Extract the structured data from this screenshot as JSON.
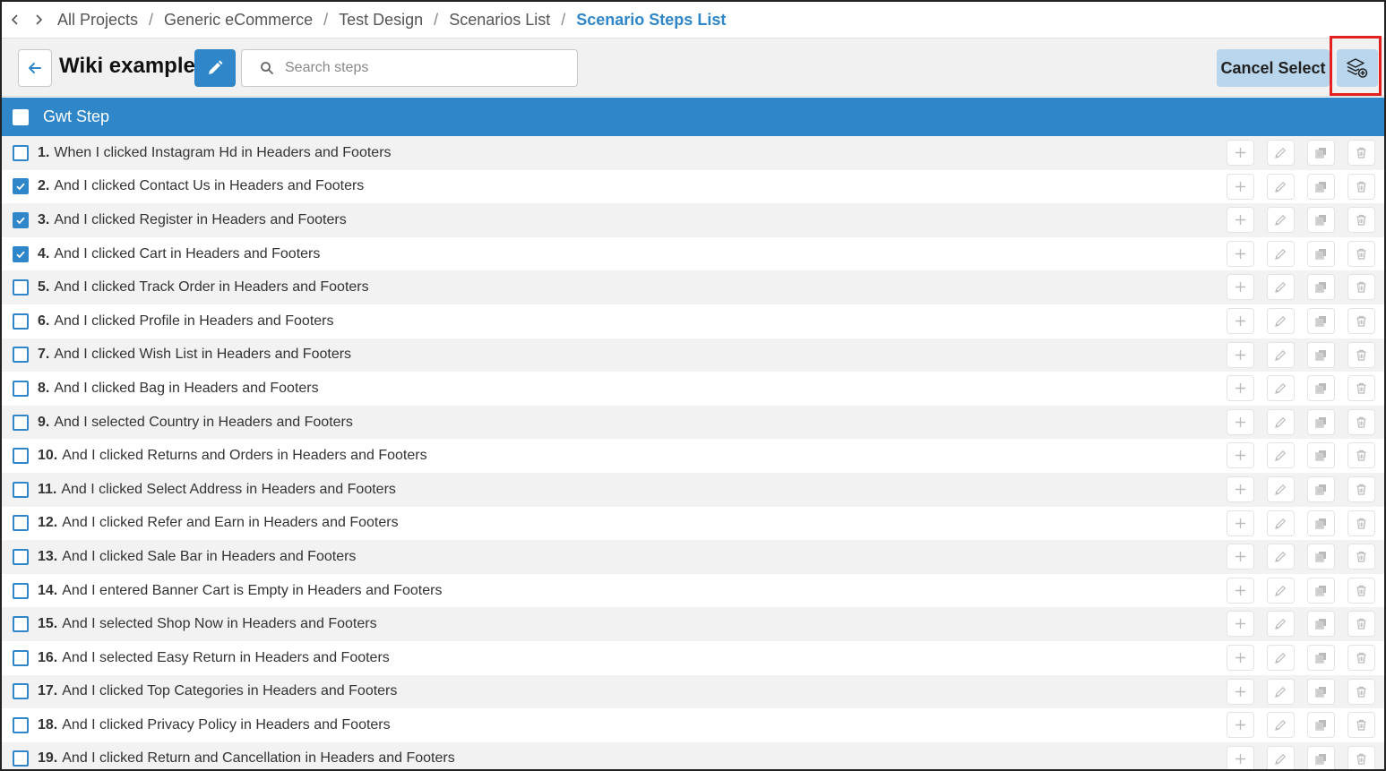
{
  "breadcrumb": {
    "items": [
      "All Projects",
      "Generic eCommerce",
      "Test Design",
      "Scenarios List"
    ],
    "current": "Scenario Steps List",
    "separator": "/"
  },
  "header": {
    "title": "Wiki example",
    "search_placeholder": "Search steps",
    "cancel_select_label": "Cancel Select"
  },
  "table": {
    "header_label": "Gwt Step",
    "rows": [
      {
        "num": "1.",
        "text": "When I clicked Instagram Hd in Headers and Footers",
        "checked": false
      },
      {
        "num": "2.",
        "text": "And I clicked Contact Us in Headers and Footers",
        "checked": true
      },
      {
        "num": "3.",
        "text": "And I clicked Register in Headers and Footers",
        "checked": true
      },
      {
        "num": "4.",
        "text": "And I clicked Cart in Headers and Footers",
        "checked": true
      },
      {
        "num": "5.",
        "text": "And I clicked Track Order in Headers and Footers",
        "checked": false
      },
      {
        "num": "6.",
        "text": "And I clicked Profile in Headers and Footers",
        "checked": false
      },
      {
        "num": "7.",
        "text": "And I clicked Wish List in Headers and Footers",
        "checked": false
      },
      {
        "num": "8.",
        "text": "And I clicked Bag in Headers and Footers",
        "checked": false
      },
      {
        "num": "9.",
        "text": "And I selected Country in Headers and Footers",
        "checked": false
      },
      {
        "num": "10.",
        "text": "And I clicked Returns and Orders in Headers and Footers",
        "checked": false
      },
      {
        "num": "11.",
        "text": "And I clicked Select Address in Headers and Footers",
        "checked": false
      },
      {
        "num": "12.",
        "text": "And I clicked Refer and Earn in Headers and Footers",
        "checked": false
      },
      {
        "num": "13.",
        "text": "And I clicked Sale Bar in Headers and Footers",
        "checked": false
      },
      {
        "num": "14.",
        "text": "And I entered Banner Cart is Empty in Headers and Footers",
        "checked": false
      },
      {
        "num": "15.",
        "text": "And I selected Shop Now in Headers and Footers",
        "checked": false
      },
      {
        "num": "16.",
        "text": "And I selected Easy Return in Headers and Footers",
        "checked": false
      },
      {
        "num": "17.",
        "text": "And I clicked Top Categories in Headers and Footers",
        "checked": false
      },
      {
        "num": "18.",
        "text": "And I clicked Privacy Policy in Headers and Footers",
        "checked": false
      },
      {
        "num": "19.",
        "text": "And I clicked Return and Cancellation in Headers and Footers",
        "checked": false
      }
    ],
    "row_actions": [
      "plus-icon",
      "pencil-icon",
      "copy-icon",
      "trash-icon"
    ]
  },
  "colors": {
    "accent": "#2f86c8",
    "accent_light": "#b9d6ec",
    "highlight": "#e32121"
  }
}
